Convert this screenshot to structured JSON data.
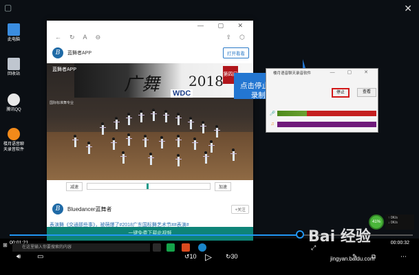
{
  "desktop": {
    "icons": [
      {
        "label": "此电脑",
        "color": "#3a8de0"
      },
      {
        "label": "回收站",
        "color": "#bfc6cf"
      },
      {
        "label": "腾讯QQ",
        "color": "#e8e8e8"
      },
      {
        "label": "楼月语音聊\n天录音软件",
        "color": "#f28a1a"
      }
    ]
  },
  "browser": {
    "app_name": "蓝舞者APP",
    "open_button": "打开看看",
    "video": {
      "brand": "蓝舞者APP",
      "title": "广舞",
      "year": "2018",
      "badge": "第四届",
      "festival": "WDC",
      "side_text": "国际标准舞专业"
    },
    "speed": {
      "slow": "减速",
      "fast": "加速"
    },
    "author": "Bluedancer蓝舞者",
    "follow": "+关注",
    "post_text": "表演舞《交通那些事》，被萌爆了#2018广东国标舞艺术节##表演#",
    "download_bar": "一键免费下载此视频"
  },
  "recorder": {
    "title": "楼月语音聊天录音软件",
    "stop_button": "停止",
    "view_button": "查看",
    "mic_color": "#c41f1f",
    "speaker_color": "#6f1a7a",
    "mic_level_color": "#4d8a1c"
  },
  "callout": {
    "text": "点击停止按钮停止录制并保存",
    "color": "#2376d1"
  },
  "player": {
    "current_time": "00:01:21",
    "total_time": "00:00:32",
    "progress": 0.72,
    "skip_back": "10",
    "skip_forward": "30"
  },
  "taskbar": {
    "search_placeholder": "在这里输入你要搜索的内容"
  },
  "tray": {
    "cpu_badge": "41%",
    "net_up": "0K/s",
    "net_down": "0K/s"
  },
  "watermark": {
    "brand": "Bai  经验",
    "url": "jingyan.baidu.com"
  }
}
